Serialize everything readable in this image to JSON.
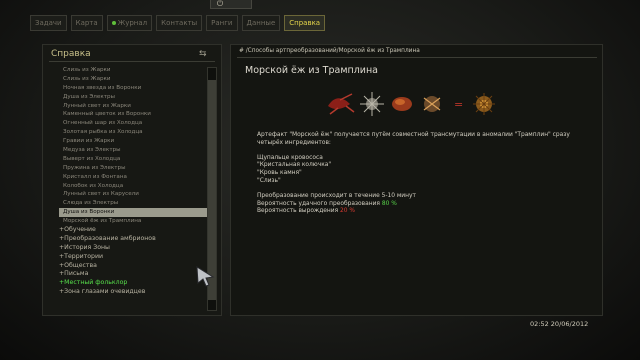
{
  "tabs": [
    {
      "label": "Задачи",
      "active": false
    },
    {
      "label": "Карта",
      "active": false
    },
    {
      "label": "Журнал",
      "active": false
    },
    {
      "label": "Контакты",
      "active": false
    },
    {
      "label": "Ранги",
      "active": false
    },
    {
      "label": "Данные",
      "active": false
    },
    {
      "label": "Справка",
      "active": true
    }
  ],
  "left": {
    "title": "Справка",
    "items": [
      "Слизь из Жарки",
      "Слизь из Жарки",
      "Ночная звезда из Воронки",
      "Душа из Электры",
      "Лунный свет из Жарки",
      "Каменный цветок из Воронки",
      "Огненный шар из Холодца",
      "Золотая рыбка из Холодца",
      "Гравии из Жарки",
      "Медуза из Электры",
      "Выверт из Холодца",
      "Пружина из Электры",
      "Кристалл из Фонтана",
      "Колобок из Холодца",
      "Лунный свет из Карусели",
      "Слюда из Электры",
      "Душа из Воронки",
      "Морской ёж из Трамплина"
    ],
    "selected_index": 16,
    "categories": [
      {
        "label": "+Обучение",
        "highlight": false
      },
      {
        "label": "+Преобразование амбрионов",
        "highlight": false
      },
      {
        "label": "+История Зоны",
        "highlight": false
      },
      {
        "label": "+Территории",
        "highlight": false
      },
      {
        "label": "+Общества",
        "highlight": false
      },
      {
        "label": "+Письма",
        "highlight": false
      },
      {
        "label": "+Местный фольклор",
        "highlight": true
      },
      {
        "label": "+Зона глазами очевидцев",
        "highlight": false
      }
    ]
  },
  "right": {
    "breadcrumb": "# /Способы артпреобразований/Морской ёж из Трамплина",
    "title": "Морской ёж из Трамплина",
    "desc_line1": "Артефакт \"Морской ёж\" получается путём совместной трансмутации в аномалии \"Трамплин\" сразу",
    "desc_line2": "четырёх ингредиентов:",
    "ingredients": [
      "Щупальце кровососа",
      "\"Кристальная колючка\"",
      "\"Кровь камня\"",
      "\"Слизь\""
    ],
    "time_line": "Преобразование происходит в течение 5-10 минут",
    "success_label": "Вероятность удачного преобразования ",
    "success_value": "80 %",
    "degrade_label": "Вероятность вырождения ",
    "degrade_value": "20 %",
    "equals_symbol": "="
  },
  "footer": {
    "datetime": "02:52  20/06/2012"
  },
  "colors": {
    "accent_yellow": "#e3d44a",
    "green": "#58d54a",
    "red": "#d83b32"
  }
}
